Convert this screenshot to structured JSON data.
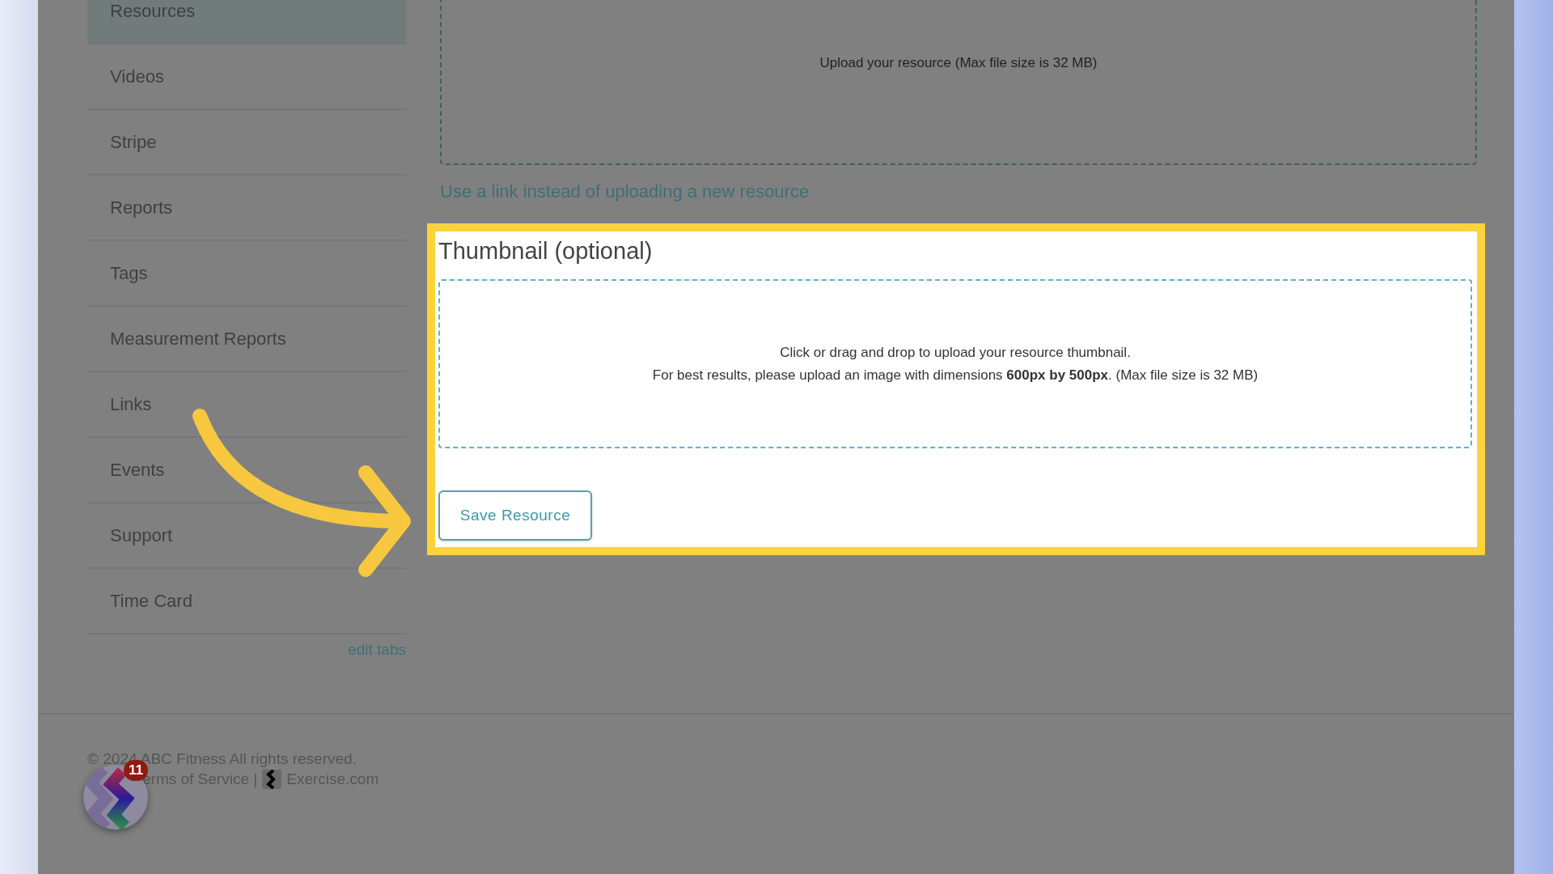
{
  "sidebar": {
    "items": [
      {
        "label": "Resources",
        "selected": true
      },
      {
        "label": "Videos",
        "selected": false
      },
      {
        "label": "Stripe",
        "selected": false
      },
      {
        "label": "Reports",
        "selected": false
      },
      {
        "label": "Tags",
        "selected": false
      },
      {
        "label": "Measurement Reports",
        "selected": false
      },
      {
        "label": "Links",
        "selected": false
      },
      {
        "label": "Events",
        "selected": false
      },
      {
        "label": "Support",
        "selected": false
      },
      {
        "label": "Time Card",
        "selected": false
      }
    ],
    "edit_link": "edit tabs"
  },
  "upload": {
    "hint": "Upload your resource (Max file size is 32 MB)",
    "link": "Use a link instead of uploading a new resource"
  },
  "thumbnail": {
    "title": "Thumbnail (optional)",
    "hint_line_1": "Click or drag and drop to upload your resource thumbnail.",
    "hint_line_2": "For best results, please upload an image with dimensions **600px by 500px**. (Max file size is 32 MB)",
    "button": "Save Resource"
  },
  "footer": {
    "copyright": "© 2024 ABC Fitness All rights reserved.",
    "links": "erms of Service |",
    "brand": "Exercise.com"
  },
  "chat_bubble": {
    "badge": "11"
  }
}
